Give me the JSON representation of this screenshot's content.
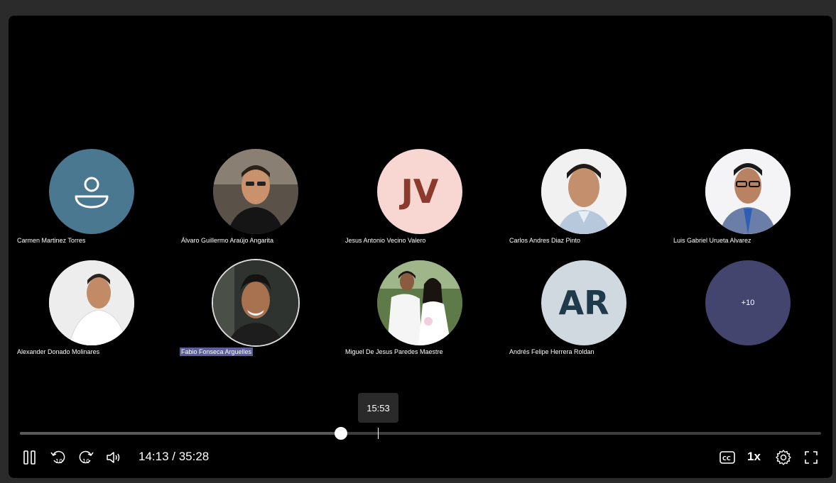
{
  "participants": [
    {
      "name": "Carmen Martinez Torres",
      "avatar": "person-placeholder-icon",
      "bg": "#4a7891"
    },
    {
      "name": "Álvaro Guillermo Araújo Angarita",
      "avatar": "photo"
    },
    {
      "name": "Jesus Antonio Vecino Valero",
      "initials": "JV",
      "bg": "#f8d7d2",
      "fg": "#8b3a2b"
    },
    {
      "name": "Carlos Andres Diaz Pinto",
      "avatar": "photo"
    },
    {
      "name": "Luis Gabriel Urueta Alvarez",
      "avatar": "photo"
    },
    {
      "name": "Alexander Donado Molinares",
      "avatar": "photo"
    },
    {
      "name": "Fabio Fonseca Arguelles",
      "avatar": "photo",
      "speaking": true
    },
    {
      "name": "Miguel De Jesus Paredes Maestre",
      "avatar": "photo"
    },
    {
      "name": "Andrés Felipe Herrera Roldan",
      "initials": "AR",
      "bg": "#cfd9df",
      "fg": "#1f3a4a"
    }
  ],
  "overflow": {
    "label": "+10",
    "bg": "#43456f"
  },
  "player": {
    "hover_time": "15:53",
    "current_time": "14:13",
    "duration": "35:28",
    "time_display": "14:13 / 35:28",
    "progress_fraction": 0.4007,
    "hover_fraction": 0.4478,
    "speed": "1x",
    "controls": [
      "pause-icon",
      "rewind-10-icon",
      "forward-10-icon",
      "volume-icon",
      "captions-icon",
      "settings-gear-icon",
      "fullscreen-icon"
    ]
  },
  "colors": {
    "background": "#000000",
    "speaking_highlight": "#5b5f9e"
  }
}
